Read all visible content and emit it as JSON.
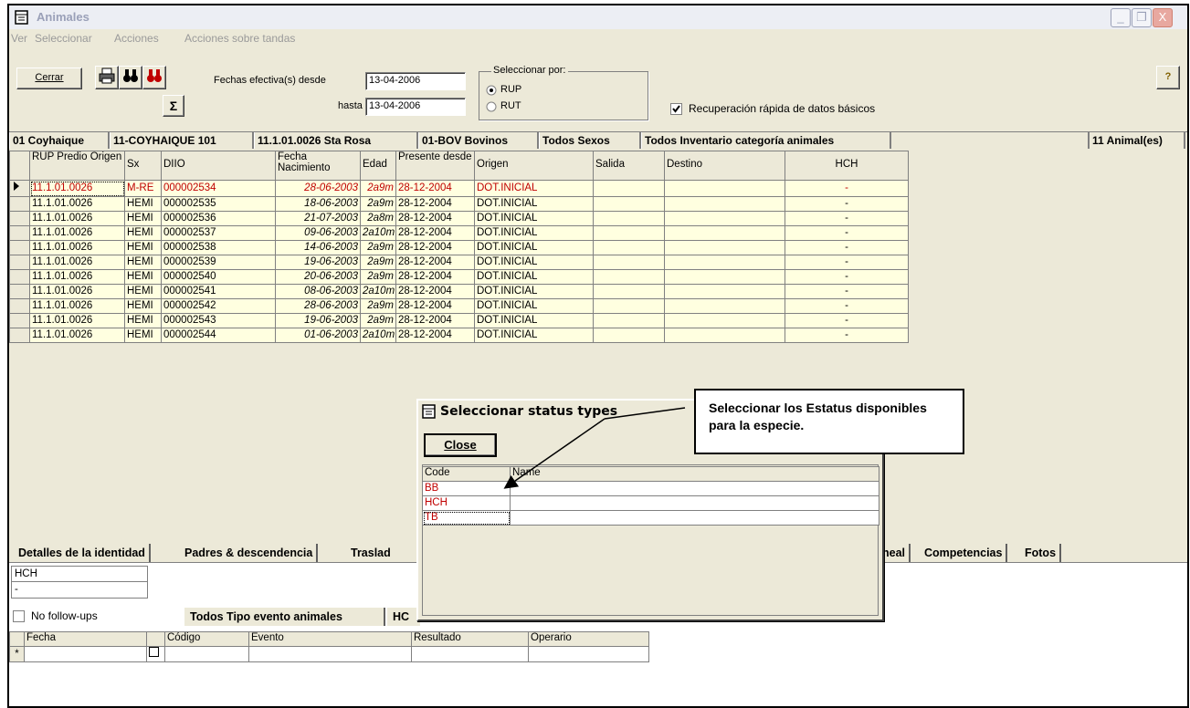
{
  "window": {
    "title": "Animales",
    "btn_min": "_",
    "btn_max": "❐",
    "btn_close": "X"
  },
  "menu": [
    "Ver",
    "Seleccionar",
    "Acciones",
    "Acciones sobre tandas"
  ],
  "toolbar": {
    "cerrar_label": "Cerrar",
    "sigma_label": "Σ",
    "fechas_desde_label": "Fechas efectiva(s) desde",
    "fechas_desde_value": "13-04-2006",
    "hasta_label": "hasta",
    "hasta_value": "13-04-2006",
    "seleccionar_por_legend": "Seleccionar por:",
    "radio_rup": "RUP",
    "radio_rut": "RUT",
    "radio_selected": "RUP",
    "recuperacion_label": "Recuperación rápida de datos básicos",
    "recuperacion_checked": true
  },
  "filters": [
    "01 Coyhaique",
    "11-COYHAIQUE 101",
    "11.1.01.0026 Sta Rosa",
    "01-BOV Bovinos",
    "Todos Sexos",
    "Todos Inventario categoría animales"
  ],
  "count_label": "11 Animal(es)",
  "grid": {
    "columns": [
      "RUP Predio Origen",
      "Sx",
      "DIIO",
      "Fecha Nacimiento",
      "Edad",
      "Presente desde",
      "Origen",
      "Salida",
      "Destino",
      "HCH"
    ],
    "rows": [
      [
        "11.1.01.0026",
        "M-RE",
        "000002534",
        "28-06-2003",
        "2a9m",
        "28-12-2004",
        "DOT.INICIAL",
        "",
        "",
        "-"
      ],
      [
        "11.1.01.0026",
        "HEMI",
        "000002535",
        "18-06-2003",
        "2a9m",
        "28-12-2004",
        "DOT.INICIAL",
        "",
        "",
        "-"
      ],
      [
        "11.1.01.0026",
        "HEMI",
        "000002536",
        "21-07-2003",
        "2a8m",
        "28-12-2004",
        "DOT.INICIAL",
        "",
        "",
        "-"
      ],
      [
        "11.1.01.0026",
        "HEMI",
        "000002537",
        "09-06-2003",
        "2a10m",
        "28-12-2004",
        "DOT.INICIAL",
        "",
        "",
        "-"
      ],
      [
        "11.1.01.0026",
        "HEMI",
        "000002538",
        "14-06-2003",
        "2a9m",
        "28-12-2004",
        "DOT.INICIAL",
        "",
        "",
        "-"
      ],
      [
        "11.1.01.0026",
        "HEMI",
        "000002539",
        "19-06-2003",
        "2a9m",
        "28-12-2004",
        "DOT.INICIAL",
        "",
        "",
        "-"
      ],
      [
        "11.1.01.0026",
        "HEMI",
        "000002540",
        "20-06-2003",
        "2a9m",
        "28-12-2004",
        "DOT.INICIAL",
        "",
        "",
        "-"
      ],
      [
        "11.1.01.0026",
        "HEMI",
        "000002541",
        "08-06-2003",
        "2a10m",
        "28-12-2004",
        "DOT.INICIAL",
        "",
        "",
        "-"
      ],
      [
        "11.1.01.0026",
        "HEMI",
        "000002542",
        "28-06-2003",
        "2a9m",
        "28-12-2004",
        "DOT.INICIAL",
        "",
        "",
        "-"
      ],
      [
        "11.1.01.0026",
        "HEMI",
        "000002543",
        "19-06-2003",
        "2a9m",
        "28-12-2004",
        "DOT.INICIAL",
        "",
        "",
        "-"
      ],
      [
        "11.1.01.0026",
        "HEMI",
        "000002544",
        "01-06-2003",
        "2a10m",
        "28-12-2004",
        "DOT.INICIAL",
        "",
        "",
        "-"
      ]
    ]
  },
  "tabs": [
    "Detalles de la identidad",
    "Padres & descendencia",
    "Traslad",
    "neal",
    "Competencias",
    "Fotos"
  ],
  "lower": {
    "hch_label": "HCH",
    "hch_value": "-",
    "no_followups_label": "No follow-ups",
    "todos_tipo_label": "Todos Tipo evento animales",
    "hc_label": "HC",
    "event_columns": [
      "Fecha",
      "",
      "Código",
      "Evento",
      "Resultado",
      "Operario"
    ],
    "new_row_marker": "*"
  },
  "dialog": {
    "title": "Seleccionar status types",
    "close_label": "Close",
    "columns": [
      "Code",
      "Name"
    ],
    "rows": [
      [
        "BB",
        ""
      ],
      [
        "HCH",
        ""
      ],
      [
        "TB",
        ""
      ]
    ]
  },
  "callout": {
    "text": "Seleccionar los Estatus disponibles para la especie."
  },
  "colors": {
    "grid_bg": "#ffffe0",
    "selected_text": "#c00000",
    "window_bg": "#ece9d8"
  }
}
